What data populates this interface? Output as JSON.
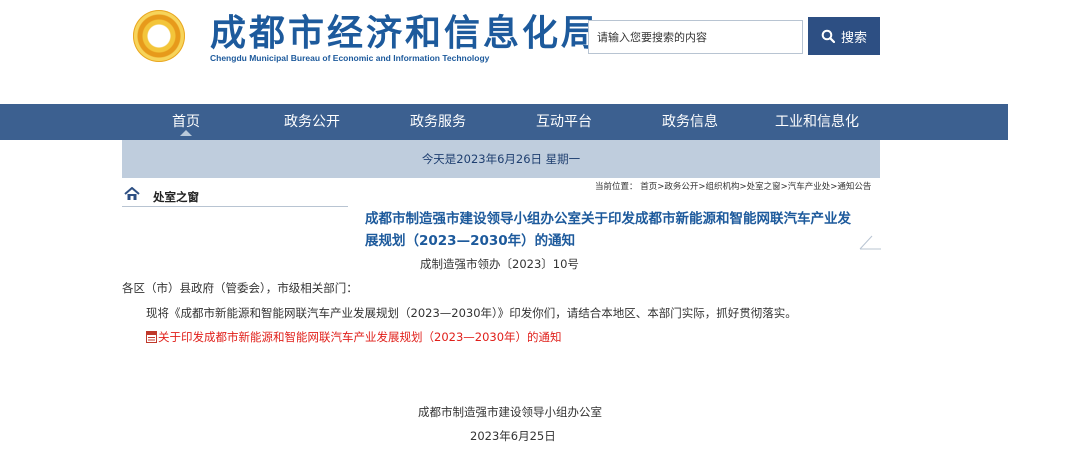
{
  "header": {
    "title": "成都市经济和信息化局",
    "subtitle": "Chengdu Municipal Bureau of Economic and Information Technology",
    "logo_icon": "sun-swirl-logo"
  },
  "search": {
    "placeholder": "请输入您要搜索的内容",
    "button_label": "搜索",
    "button_icon": "search-icon"
  },
  "nav": {
    "items": [
      "首页",
      "政务公开",
      "政务服务",
      "互动平台",
      "政务信息",
      "工业和信息化"
    ],
    "active": "首页"
  },
  "date_bar": "今天是2023年6月26日 星期一",
  "sidebar": {
    "label": "处室之窗",
    "icon": "house-icon"
  },
  "breadcrumb": "当前位置： 首页>政务公开>组织机构>处室之窗>汽车产业处>通知公告",
  "article": {
    "title": "成都市制造强市建设领导小组办公室关于印发成都市新能源和智能网联汽车产业发展规划（2023—2030年）的通知",
    "doc_number": "成制造强市领办〔2023〕10号",
    "salutation": "各区（市）县政府（管委会），市级相关部门：",
    "body": "现将《成都市新能源和智能网联汽车产业发展规划（2023—2030年）》印发你们，请结合本地区、本部门实际，抓好贯彻落实。",
    "attachment": "关于印发成都市新能源和智能网联汽车产业发展规划（2023—2030年）的通知",
    "attachment_icon": "pdf-file-icon",
    "signature": "成都市制造强市建设领导小组办公室",
    "sign_date": "2023年6月25日"
  },
  "colors": {
    "brand_blue": "#1d5a9c",
    "nav_bg": "#3c6090",
    "search_button": "#2d4f83",
    "date_bar": "#bfcddd",
    "link_red": "#e0201b"
  }
}
